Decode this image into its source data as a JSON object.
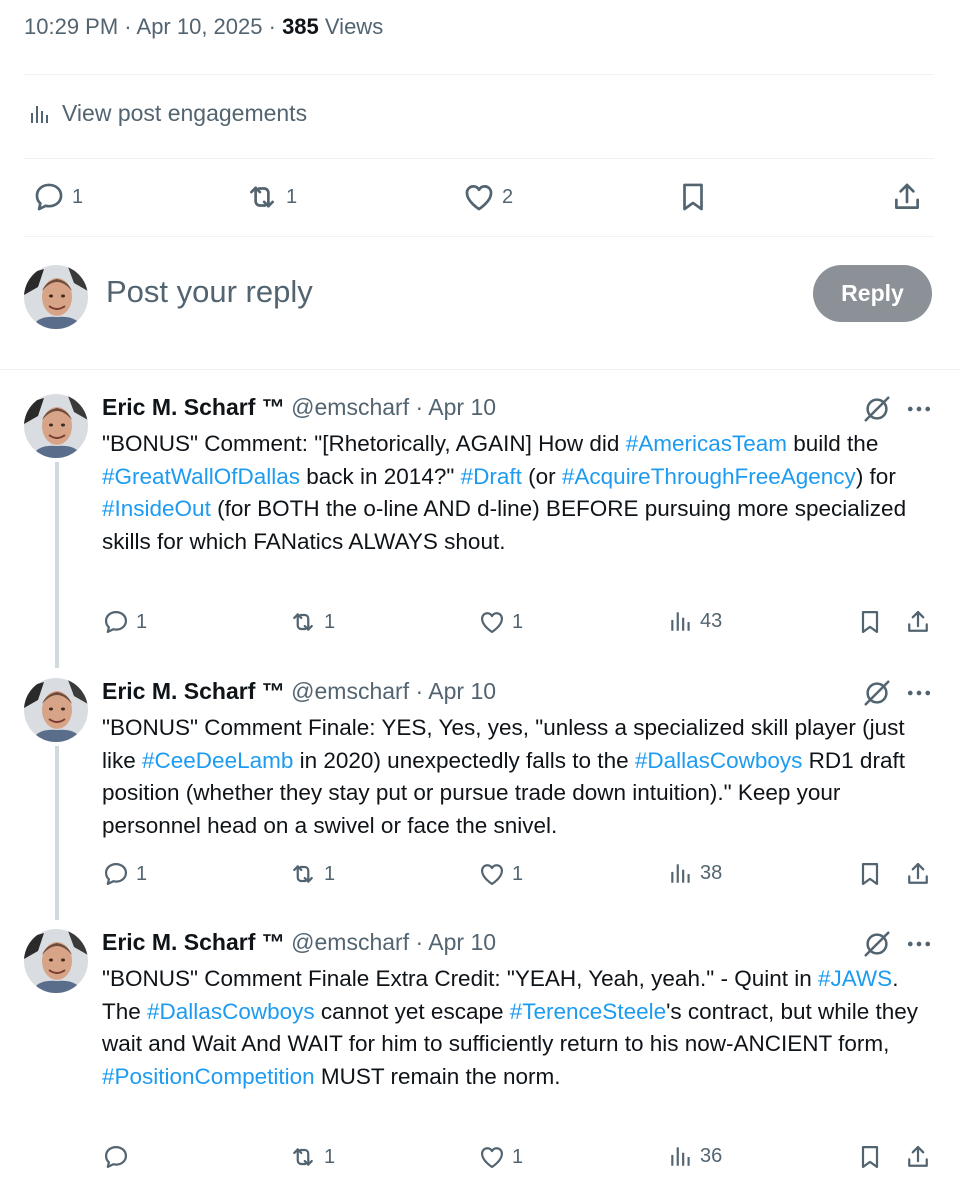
{
  "header": {
    "time": "10:29 PM",
    "date": "Apr 10, 2025",
    "views_count": "385",
    "views_label": "Views",
    "engagements_label": "View post engagements"
  },
  "main_actions": {
    "replies": "1",
    "reposts": "1",
    "likes": "2"
  },
  "reply_box": {
    "placeholder": "Post your reply",
    "button_label": "Reply"
  },
  "posts": [
    {
      "name": "Eric M. Scharf ™",
      "handle": "@emscharf",
      "date": "Apr 10",
      "segments": [
        {
          "t": "\"BONUS\" Comment: \"[Rhetorically, AGAIN] How did "
        },
        {
          "t": "#AmericasTeam",
          "tag": true
        },
        {
          "t": " build the "
        },
        {
          "t": "#GreatWallOfDallas",
          "tag": true
        },
        {
          "t": " back in 2014?\" "
        },
        {
          "t": "#Draft",
          "tag": true
        },
        {
          "t": " (or "
        },
        {
          "t": "#AcquireThroughFreeAgency",
          "tag": true
        },
        {
          "t": ") for "
        },
        {
          "t": "#InsideOut",
          "tag": true
        },
        {
          "t": " (for BOTH the o-line AND d-line) BEFORE pursuing more specialized skills for which FANatics ALWAYS shout."
        }
      ],
      "replies": "1",
      "reposts": "1",
      "likes": "1",
      "views": "43"
    },
    {
      "name": "Eric M. Scharf ™",
      "handle": "@emscharf",
      "date": "Apr 10",
      "segments": [
        {
          "t": "\"BONUS\" Comment Finale: YES, Yes, yes, \"unless a specialized skill player (just like "
        },
        {
          "t": "#CeeDeeLamb",
          "tag": true
        },
        {
          "t": " in 2020) unexpectedly falls to the "
        },
        {
          "t": "#DallasCowboys",
          "tag": true
        },
        {
          "t": " RD1 draft position (whether they stay put or pursue trade down intuition).\" Keep your personnel head on a swivel or face the snivel."
        }
      ],
      "replies": "1",
      "reposts": "1",
      "likes": "1",
      "views": "38"
    },
    {
      "name": "Eric M. Scharf ™",
      "handle": "@emscharf",
      "date": "Apr 10",
      "segments": [
        {
          "t": "\"BONUS\" Comment Finale Extra Credit: \"YEAH, Yeah, yeah.\" - Quint in "
        },
        {
          "t": "#JAWS",
          "tag": true
        },
        {
          "t": ". The "
        },
        {
          "t": "#DallasCowboys",
          "tag": true
        },
        {
          "t": " cannot yet escape "
        },
        {
          "t": "#TerenceSteele",
          "tag": true
        },
        {
          "t": "'s contract, but while they wait and Wait And WAIT for him to sufficiently return to his now-ANCIENT form, "
        },
        {
          "t": "#PositionCompetition",
          "tag": true
        },
        {
          "t": " MUST remain the norm."
        }
      ],
      "replies": "",
      "reposts": "1",
      "likes": "1",
      "views": "36"
    }
  ],
  "colors": {
    "text": "#0f1419",
    "secondary": "#536471",
    "link": "#1d9bf0",
    "reply_button": "#8b9196",
    "thread_line": "#cfd9de"
  }
}
